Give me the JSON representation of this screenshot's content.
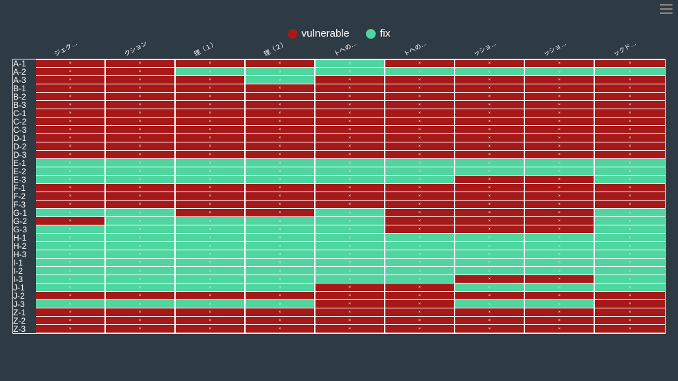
{
  "legend": {
    "vulnerable": "vulnerable",
    "fix": "fix"
  },
  "chart_data": {
    "type": "heatmap",
    "title": "",
    "xlabel": "",
    "ylabel": "",
    "legend_position": "top",
    "col_headers": [
      "ジェク…",
      "クション",
      "理（１）",
      "理（２）",
      "トへの…",
      "トへの…",
      "ッショ…",
      "ッショ…",
      "ックド…"
    ],
    "row_labels": [
      "A-1",
      "A-2",
      "A-3",
      "B-1",
      "B-2",
      "B-3",
      "C-1",
      "C-2",
      "C-3",
      "D-1",
      "D-2",
      "D-3",
      "E-1",
      "E-2",
      "E-3",
      "F-1",
      "F-2",
      "F-3",
      "G-1",
      "G-2",
      "G-3",
      "H-1",
      "H-2",
      "H-3",
      "I-1",
      "I-2",
      "I-3",
      "J-1",
      "J-2",
      "J-3",
      "Z-1",
      "Z-2",
      "Z-3"
    ],
    "value_meaning": {
      "x": "vulnerable",
      "o": "fix"
    },
    "series": [
      {
        "name": "A-1",
        "values": [
          "x",
          "x",
          "x",
          "x",
          "o",
          "x",
          "x",
          "x",
          "x"
        ]
      },
      {
        "name": "A-2",
        "values": [
          "x",
          "x",
          "o",
          "o",
          "o",
          "o",
          "o",
          "o",
          "o"
        ]
      },
      {
        "name": "A-3",
        "values": [
          "x",
          "x",
          "x",
          "o",
          "x",
          "x",
          "x",
          "x",
          "x"
        ]
      },
      {
        "name": "B-1",
        "values": [
          "x",
          "x",
          "x",
          "x",
          "x",
          "x",
          "x",
          "x",
          "x"
        ]
      },
      {
        "name": "B-2",
        "values": [
          "x",
          "x",
          "x",
          "x",
          "x",
          "x",
          "x",
          "x",
          "x"
        ]
      },
      {
        "name": "B-3",
        "values": [
          "x",
          "x",
          "x",
          "x",
          "x",
          "x",
          "x",
          "x",
          "x"
        ]
      },
      {
        "name": "C-1",
        "values": [
          "x",
          "x",
          "x",
          "x",
          "x",
          "x",
          "x",
          "x",
          "x"
        ]
      },
      {
        "name": "C-2",
        "values": [
          "x",
          "x",
          "x",
          "x",
          "x",
          "x",
          "x",
          "x",
          "x"
        ]
      },
      {
        "name": "C-3",
        "values": [
          "x",
          "x",
          "x",
          "x",
          "x",
          "x",
          "x",
          "x",
          "x"
        ]
      },
      {
        "name": "D-1",
        "values": [
          "x",
          "x",
          "x",
          "x",
          "x",
          "x",
          "x",
          "x",
          "x"
        ]
      },
      {
        "name": "D-2",
        "values": [
          "x",
          "x",
          "x",
          "x",
          "x",
          "x",
          "x",
          "x",
          "x"
        ]
      },
      {
        "name": "D-3",
        "values": [
          "x",
          "x",
          "x",
          "x",
          "x",
          "x",
          "x",
          "x",
          "x"
        ]
      },
      {
        "name": "E-1",
        "values": [
          "o",
          "o",
          "o",
          "o",
          "o",
          "o",
          "o",
          "o",
          "o"
        ]
      },
      {
        "name": "E-2",
        "values": [
          "o",
          "o",
          "o",
          "o",
          "o",
          "o",
          "o",
          "o",
          "o"
        ]
      },
      {
        "name": "E-3",
        "values": [
          "o",
          "o",
          "o",
          "o",
          "o",
          "o",
          "x",
          "x",
          "o"
        ]
      },
      {
        "name": "F-1",
        "values": [
          "x",
          "x",
          "x",
          "x",
          "x",
          "x",
          "x",
          "x",
          "x"
        ]
      },
      {
        "name": "F-2",
        "values": [
          "x",
          "x",
          "x",
          "x",
          "x",
          "x",
          "x",
          "x",
          "x"
        ]
      },
      {
        "name": "F-3",
        "values": [
          "x",
          "x",
          "x",
          "x",
          "x",
          "x",
          "x",
          "x",
          "x"
        ]
      },
      {
        "name": "G-1",
        "values": [
          "o",
          "o",
          "x",
          "x",
          "o",
          "x",
          "x",
          "x",
          "o"
        ]
      },
      {
        "name": "G-2",
        "values": [
          "x",
          "o",
          "o",
          "o",
          "o",
          "x",
          "x",
          "x",
          "o"
        ]
      },
      {
        "name": "G-3",
        "values": [
          "o",
          "o",
          "o",
          "o",
          "o",
          "x",
          "x",
          "x",
          "o"
        ]
      },
      {
        "name": "H-1",
        "values": [
          "o",
          "o",
          "o",
          "o",
          "o",
          "o",
          "o",
          "o",
          "o"
        ]
      },
      {
        "name": "H-2",
        "values": [
          "o",
          "o",
          "o",
          "o",
          "o",
          "o",
          "o",
          "o",
          "o"
        ]
      },
      {
        "name": "H-3",
        "values": [
          "o",
          "o",
          "o",
          "o",
          "o",
          "o",
          "o",
          "o",
          "o"
        ]
      },
      {
        "name": "I-1",
        "values": [
          "o",
          "o",
          "o",
          "o",
          "o",
          "o",
          "o",
          "o",
          "o"
        ]
      },
      {
        "name": "I-2",
        "values": [
          "o",
          "o",
          "o",
          "o",
          "o",
          "o",
          "o",
          "o",
          "o"
        ]
      },
      {
        "name": "I-3",
        "values": [
          "o",
          "o",
          "o",
          "o",
          "o",
          "o",
          "x",
          "x",
          "o"
        ]
      },
      {
        "name": "J-1",
        "values": [
          "o",
          "o",
          "o",
          "o",
          "x",
          "x",
          "o",
          "o",
          "o"
        ]
      },
      {
        "name": "J-2",
        "values": [
          "x",
          "x",
          "x",
          "x",
          "x",
          "x",
          "x",
          "x",
          "x"
        ]
      },
      {
        "name": "J-3",
        "values": [
          "o",
          "o",
          "o",
          "o",
          "x",
          "x",
          "o",
          "o",
          "x"
        ]
      },
      {
        "name": "Z-1",
        "values": [
          "x",
          "x",
          "x",
          "x",
          "x",
          "x",
          "x",
          "x",
          "x"
        ]
      },
      {
        "name": "Z-2",
        "values": [
          "x",
          "x",
          "x",
          "x",
          "x",
          "x",
          "x",
          "x",
          "x"
        ]
      },
      {
        "name": "Z-3",
        "values": [
          "x",
          "x",
          "x",
          "x",
          "x",
          "x",
          "x",
          "x",
          "x"
        ]
      }
    ]
  },
  "colors": {
    "vulnerable": "#a61919",
    "fix": "#4fd6a0",
    "bg": "#2f3b44",
    "grid": "#ffffff"
  }
}
